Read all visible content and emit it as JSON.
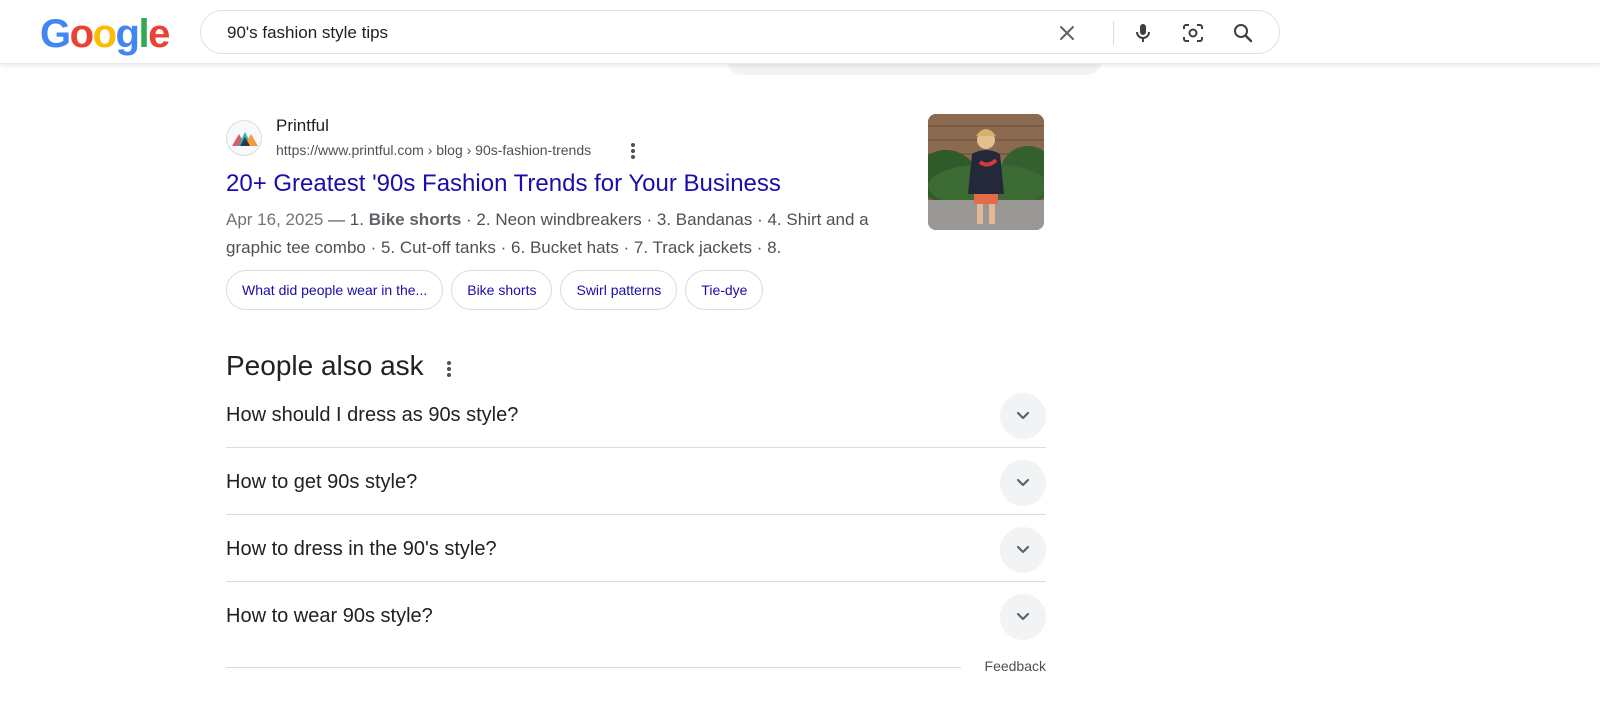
{
  "header": {
    "logo": {
      "letters": [
        "G",
        "o",
        "o",
        "g",
        "l",
        "e"
      ],
      "colors": [
        "#4285F4",
        "#EA4335",
        "#FBBC05",
        "#4285F4",
        "#34A853",
        "#EA4335"
      ]
    },
    "search": {
      "query": "90's fashion style tips",
      "icons": [
        "close-icon",
        "mic-icon",
        "lens-icon",
        "search-icon"
      ]
    }
  },
  "result": {
    "site_name": "Printful",
    "url": "https://www.printful.com › blog › 90s-fashion-trends",
    "title": "20+ Greatest '90s Fashion Trends for Your Business",
    "snippet": {
      "date": "Apr 16, 2025",
      "sep": " — 1. ",
      "bold": "Bike shorts",
      "rest": " · 2. Neon windbreakers · 3. Bandanas · 4. Shirt and a graphic tee combo · 5. Cut-off tanks · 6. Bucket hats · 7. Track jackets · 8."
    },
    "chips": [
      "What did people wear in the...",
      "Bike shorts",
      "Swirl patterns",
      "Tie-dye"
    ],
    "link_color": "#1a0dab"
  },
  "paa": {
    "title": "People also ask",
    "questions": [
      "How should I dress as 90s style?",
      "How to get 90s style?",
      "How to dress in the 90's style?",
      "How to wear 90s style?"
    ],
    "feedback": "Feedback"
  }
}
